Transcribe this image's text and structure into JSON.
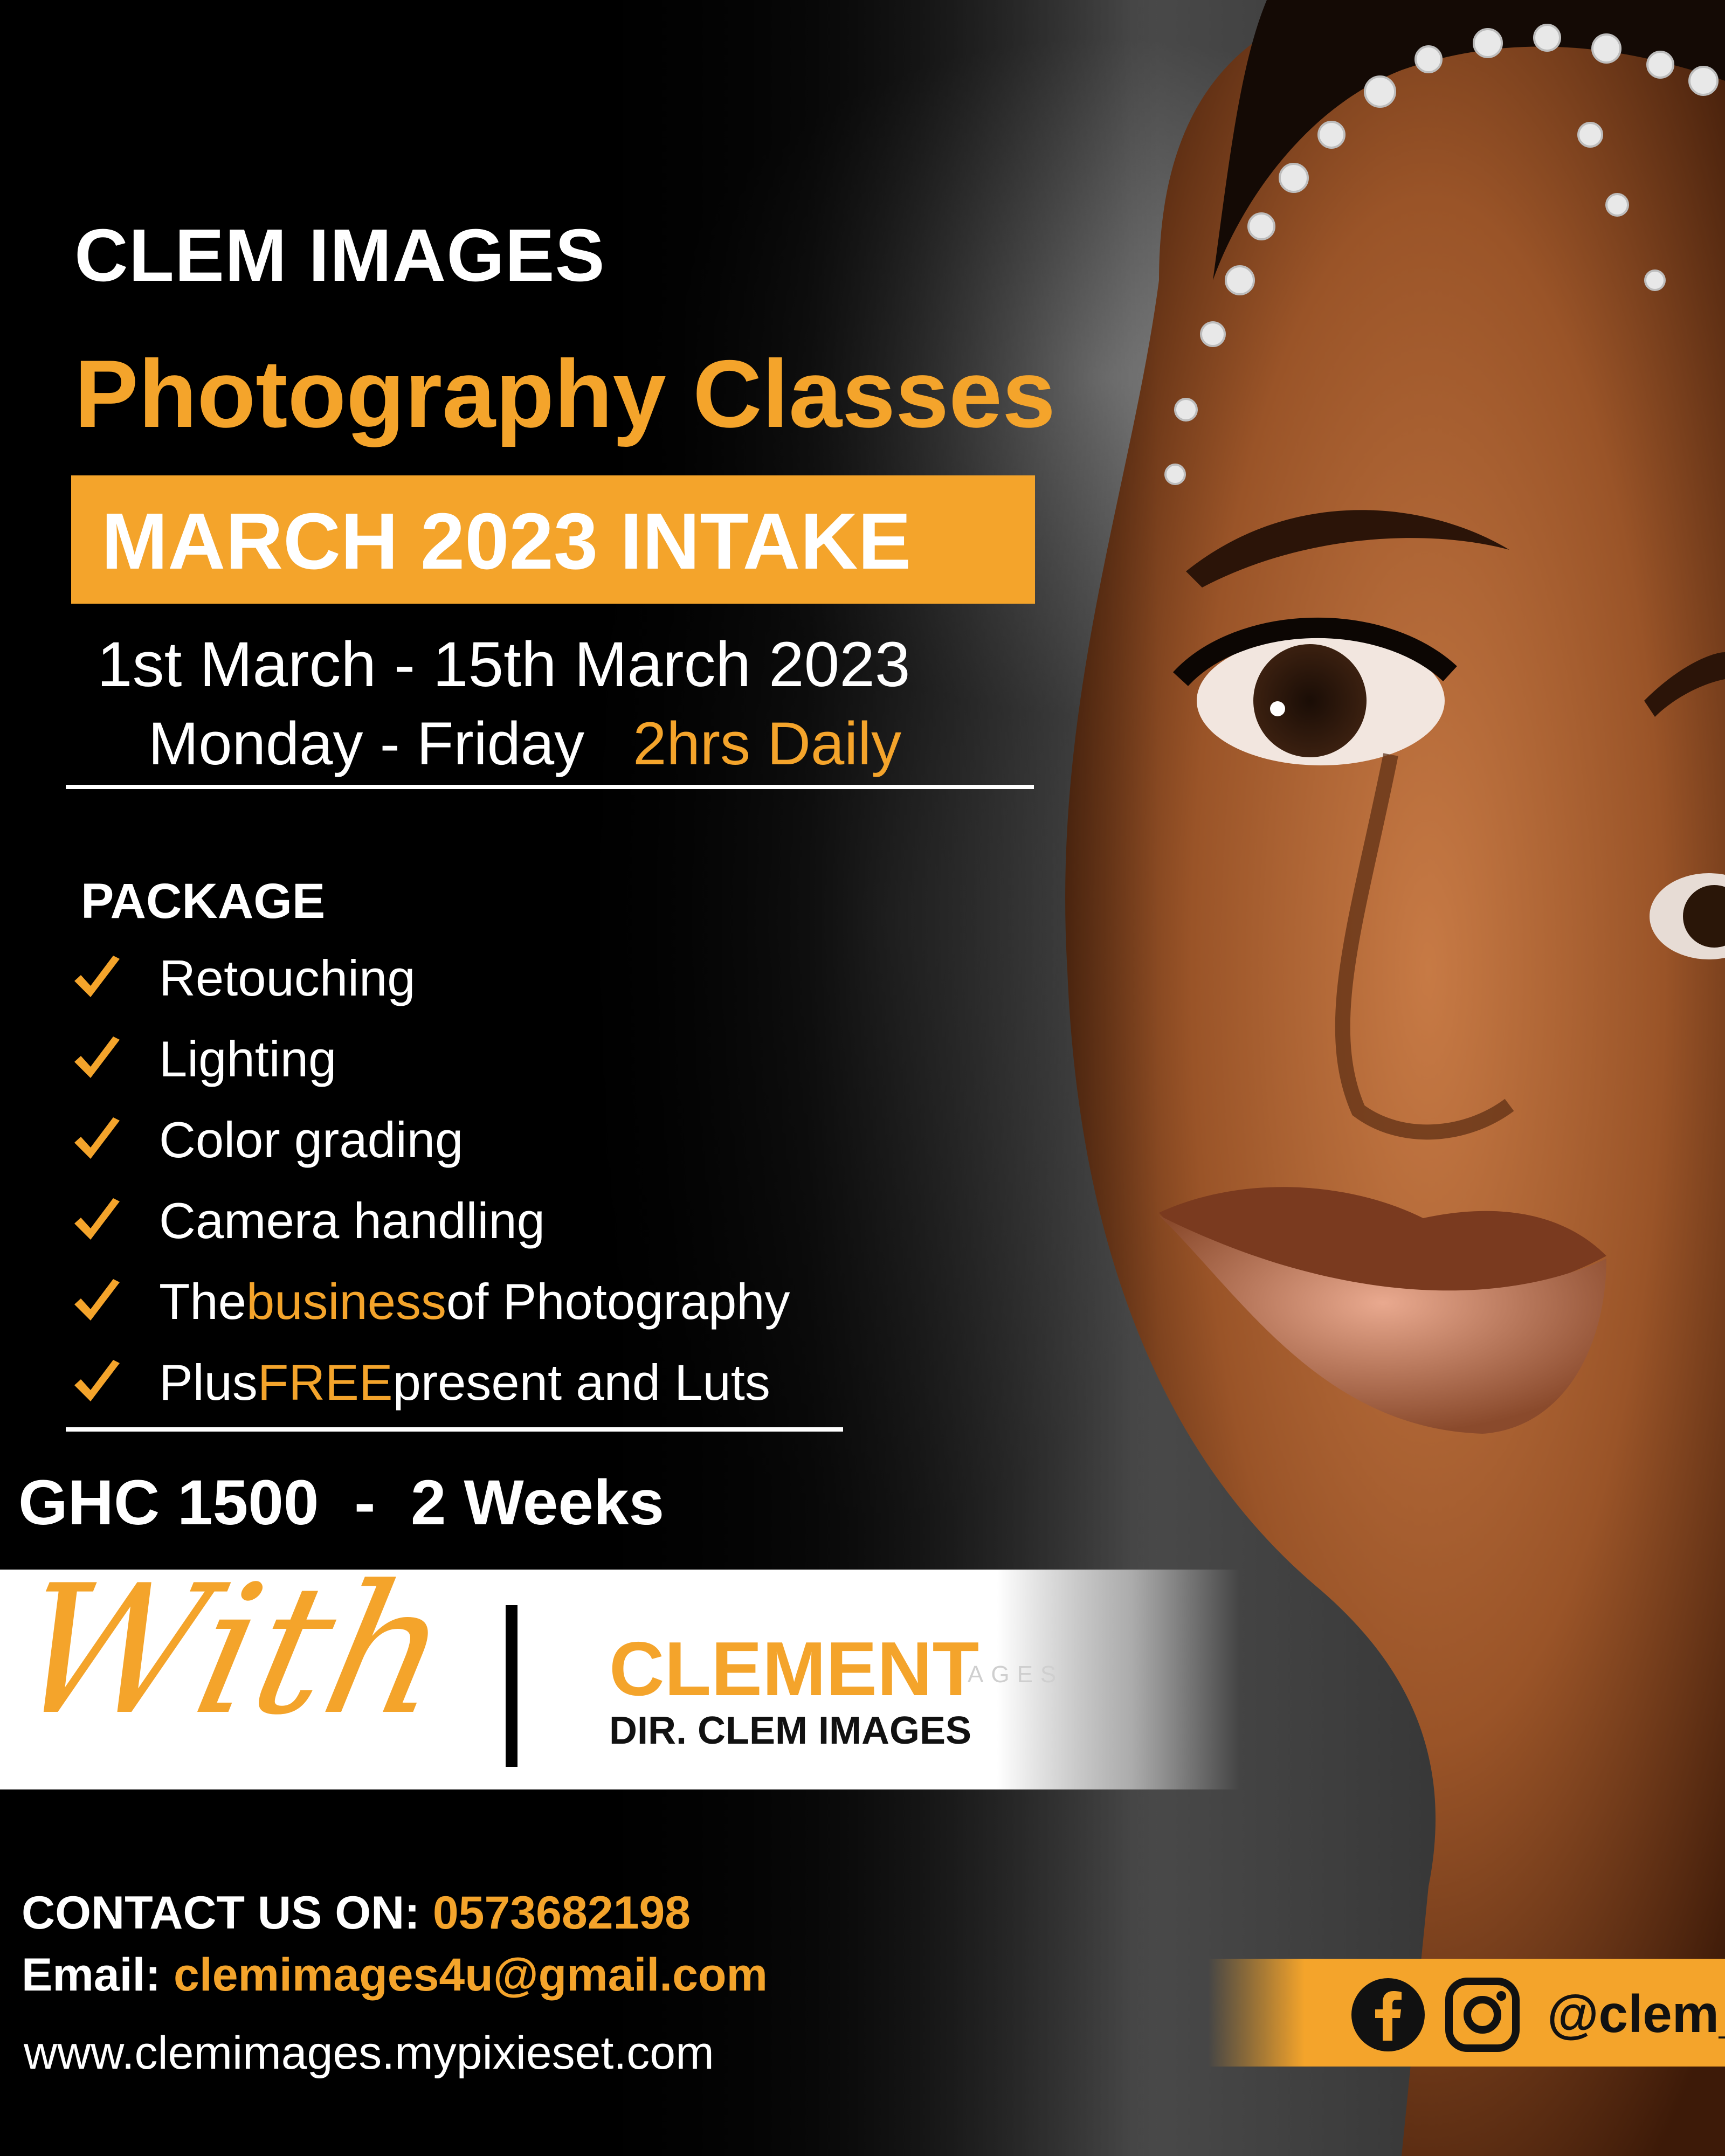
{
  "brand": "CLEM IMAGES",
  "title": "Photography Classes",
  "intake": "MARCH 2023 INTAKE",
  "dates": "1st March - 15th March 2023",
  "schedule": {
    "days": "Monday - Friday",
    "hours": "2hrs Daily"
  },
  "package": {
    "heading": "PACKAGE",
    "items": [
      {
        "before": "Retouching",
        "highlight": "",
        "after": ""
      },
      {
        "before": "Lighting",
        "highlight": "",
        "after": ""
      },
      {
        "before": "Color grading",
        "highlight": "",
        "after": ""
      },
      {
        "before": "Camera handling",
        "highlight": "",
        "after": ""
      },
      {
        "before": "The ",
        "highlight": "business",
        "after": " of Photography"
      },
      {
        "before": "Plus ",
        "highlight": "FREE",
        "after": " present and Luts"
      }
    ]
  },
  "price": "GHC 1500  -  2 Weeks",
  "instructor": {
    "script": "With",
    "name": "CLEMENT",
    "faint": "AGES",
    "role": "DIR. CLEM IMAGES"
  },
  "contact": {
    "phone_label": "CONTACT US ON:",
    "phone": "0573682198",
    "email_label": "Email:",
    "email": "clemimages4u@gmail.com",
    "website": "www.clemimages.mypixieset.com"
  },
  "social": {
    "icons": [
      "facebook-icon",
      "instagram-icon"
    ],
    "handle": "@clem_"
  },
  "colors": {
    "accent": "#f4a42b",
    "background": "#000000",
    "band": "#ffffff"
  }
}
